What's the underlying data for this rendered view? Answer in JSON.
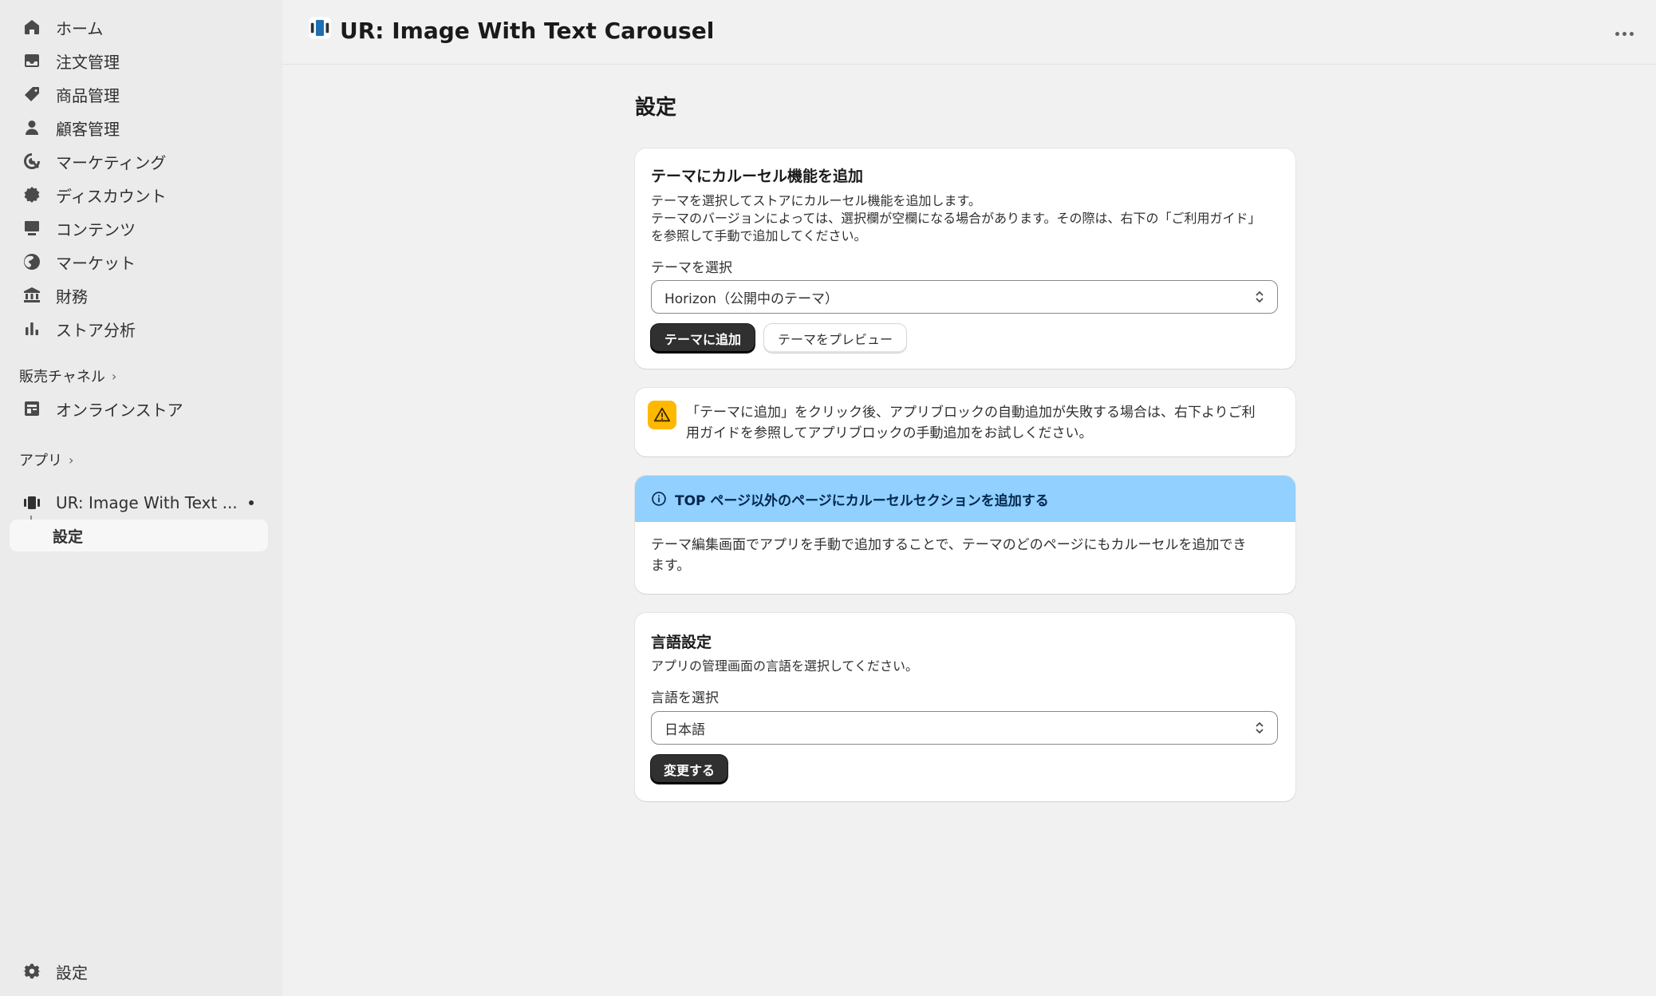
{
  "sidebar": {
    "items": [
      {
        "label": "ホーム",
        "icon": "home-icon"
      },
      {
        "label": "注文管理",
        "icon": "inbox-icon"
      },
      {
        "label": "商品管理",
        "icon": "tag-icon"
      },
      {
        "label": "顧客管理",
        "icon": "person-icon"
      },
      {
        "label": "マーケティング",
        "icon": "target-icon"
      },
      {
        "label": "ディスカウント",
        "icon": "discount-icon"
      },
      {
        "label": "コンテンツ",
        "icon": "content-icon"
      },
      {
        "label": "マーケット",
        "icon": "globe-icon"
      },
      {
        "label": "財務",
        "icon": "bank-icon"
      },
      {
        "label": "ストア分析",
        "icon": "analytics-icon"
      }
    ],
    "sales_channels_label": "販売チャネル",
    "online_store_label": "オンラインストア",
    "apps_label": "アプリ",
    "app_name": "UR: Image With Text ...",
    "app_sub_item": "設定",
    "settings_label": "設定"
  },
  "header": {
    "title": "UR: Image With Text Carousel"
  },
  "main": {
    "page_title": "設定",
    "theme_card": {
      "title": "テーマにカルーセル機能を追加",
      "description_line1": "テーマを選択してストアにカルーセル機能を追加します。",
      "description_line2": "テーマのバージョンによっては、選択欄が空欄になる場合があります。その際は、右下の「ご利用ガイド」",
      "description_line3": "を参照して手動で追加してください。",
      "select_label": "テーマを選択",
      "select_value": "Horizon（公開中のテーマ）",
      "add_button": "テーマに追加",
      "preview_button": "テーマをプレビュー"
    },
    "warning": {
      "line1": "「テーマに追加」をクリック後、アプリブロックの自動追加が失敗する場合は、右下よりご利",
      "line2": "用ガイドを参照してアプリブロックの手動追加をお試しください。"
    },
    "info_card": {
      "title": "TOP ページ以外のページにカルーセルセクションを追加する",
      "line1": "テーマ編集画面でアプリを手動で追加することで、テーマのどのページにもカルーセルを追加でき",
      "line2": "ます。"
    },
    "language_card": {
      "title": "言語設定",
      "description": "アプリの管理画面の言語を選択してください。",
      "select_label": "言語を選択",
      "select_value": "日本語",
      "change_button": "変更する"
    }
  },
  "colors": {
    "warning": "#ffb800",
    "info": "#91d0ff",
    "primary_button": "#303030"
  }
}
